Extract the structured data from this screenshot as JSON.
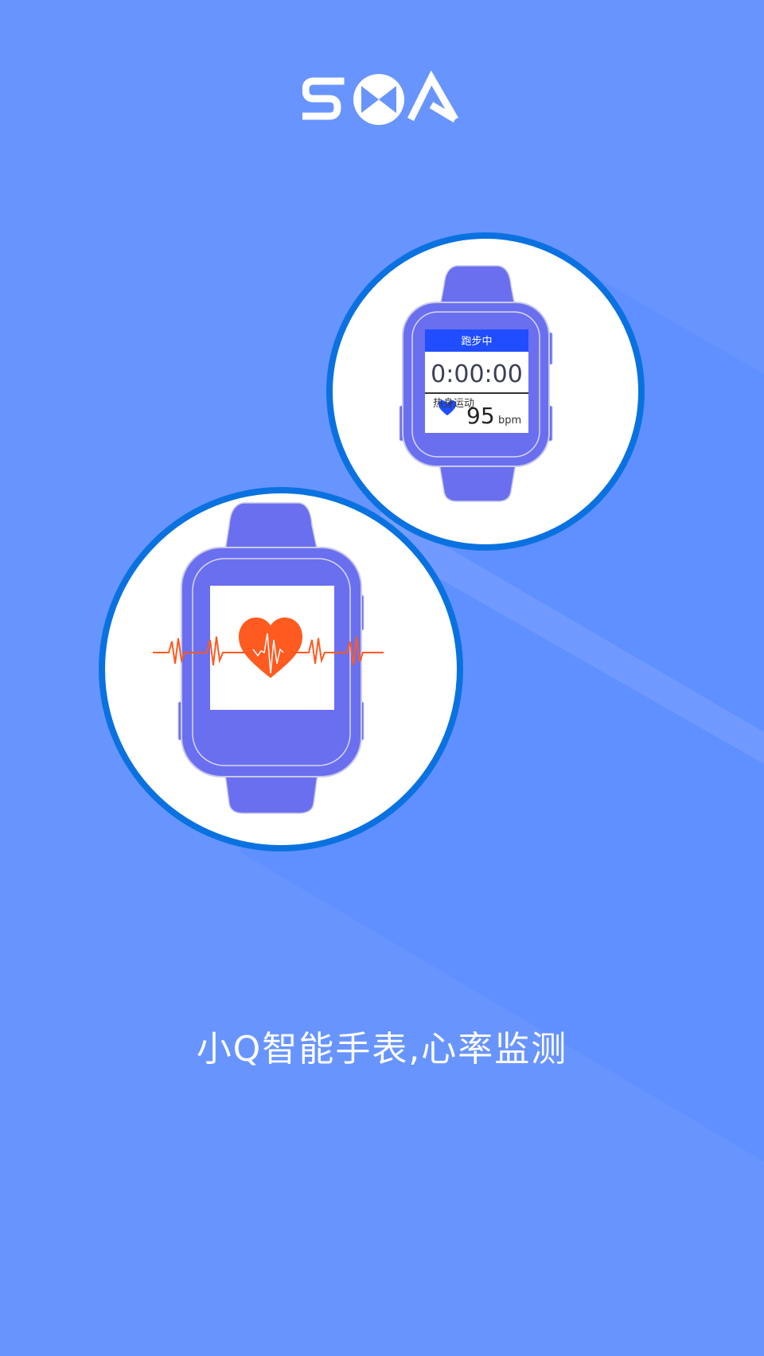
{
  "brand": {
    "logo_text": "SOA"
  },
  "watch_run": {
    "status_label": "跑步中",
    "timer": "0:00:00",
    "mode_label": "热身运动",
    "heart_rate": "95",
    "heart_rate_unit": "bpm"
  },
  "tagline": "小Q智能手表,心率监测",
  "colors": {
    "background": "#6894fe",
    "circle_border": "#0a72e0",
    "watch_body": "#6a6ff0",
    "watch_header": "#1f4dff",
    "heart": "#ff5a1f"
  },
  "icons": {
    "logo": "soa-logo",
    "heart_small": "heart-icon",
    "heart_big": "heart-pulse-icon"
  }
}
